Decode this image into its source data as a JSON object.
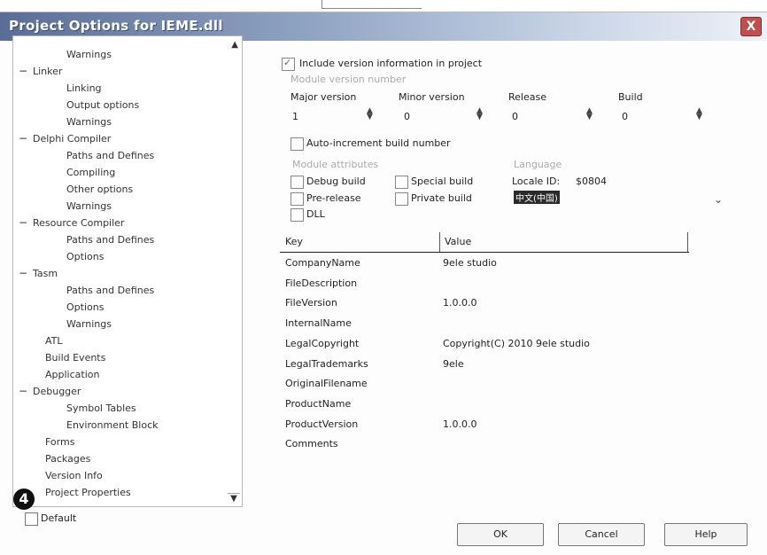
{
  "window": {
    "title": "Project Options for IEME.dll",
    "close_label": "X"
  },
  "tree": {
    "items": [
      {
        "label": "Warnings",
        "level": 2,
        "expander": ""
      },
      {
        "label": "Linker",
        "level": 1,
        "expander": "−"
      },
      {
        "label": "Linking",
        "level": 2,
        "expander": ""
      },
      {
        "label": "Output options",
        "level": 2,
        "expander": ""
      },
      {
        "label": "Warnings",
        "level": 2,
        "expander": ""
      },
      {
        "label": "Delphi Compiler",
        "level": 1,
        "expander": "−"
      },
      {
        "label": "Paths and Defines",
        "level": 2,
        "expander": ""
      },
      {
        "label": "Compiling",
        "level": 2,
        "expander": ""
      },
      {
        "label": "Other options",
        "level": 2,
        "expander": ""
      },
      {
        "label": "Warnings",
        "level": 2,
        "expander": ""
      },
      {
        "label": "Resource Compiler",
        "level": 1,
        "expander": "−"
      },
      {
        "label": "Paths and Defines",
        "level": 2,
        "expander": ""
      },
      {
        "label": "Options",
        "level": 2,
        "expander": ""
      },
      {
        "label": "Tasm",
        "level": 1,
        "expander": "−"
      },
      {
        "label": "Paths and Defines",
        "level": 2,
        "expander": ""
      },
      {
        "label": "Options",
        "level": 2,
        "expander": ""
      },
      {
        "label": "Warnings",
        "level": 2,
        "expander": ""
      },
      {
        "label": "ATL",
        "level": 0,
        "expander": ""
      },
      {
        "label": "Build Events",
        "level": 0,
        "expander": ""
      },
      {
        "label": "Application",
        "level": 0,
        "expander": ""
      },
      {
        "label": "Debugger",
        "level": 1,
        "expander": "−"
      },
      {
        "label": "Symbol Tables",
        "level": 2,
        "expander": ""
      },
      {
        "label": "Environment Block",
        "level": 2,
        "expander": ""
      },
      {
        "label": "Forms",
        "level": 0,
        "expander": ""
      },
      {
        "label": "Packages",
        "level": 0,
        "expander": ""
      },
      {
        "label": "Version Info",
        "level": 0,
        "expander": ""
      },
      {
        "label": "Project Properties",
        "level": 0,
        "expander": ""
      }
    ]
  },
  "badge": "4",
  "default_checkbox": {
    "label": "Default",
    "checked": false
  },
  "version": {
    "include_label": "Include version information in project",
    "include_checked": true,
    "module_version_label": "Module version number",
    "fields": [
      {
        "label": "Major version",
        "value": "1"
      },
      {
        "label": "Minor version",
        "value": "0"
      },
      {
        "label": "Release",
        "value": "0"
      },
      {
        "label": "Build",
        "value": "0"
      }
    ],
    "auto_increment_label": "Auto-increment build number",
    "module_attributes_label": "Module attributes",
    "attributes": [
      {
        "label": "Debug build",
        "checked": false
      },
      {
        "label": "Special build",
        "checked": false
      },
      {
        "label": "Pre-release",
        "checked": false
      },
      {
        "label": "Private build",
        "checked": false
      },
      {
        "label": "DLL",
        "checked": false
      }
    ],
    "language_label": "Language",
    "locale_label": "Locale ID:",
    "locale_value": "$0804",
    "locale_select_text": "中文(中国)"
  },
  "table": {
    "key_header": "Key",
    "value_header": "Value",
    "rows": [
      {
        "key": "CompanyName",
        "value": "9ele studio"
      },
      {
        "key": "FileDescription",
        "value": ""
      },
      {
        "key": "FileVersion",
        "value": "1.0.0.0"
      },
      {
        "key": "InternalName",
        "value": ""
      },
      {
        "key": "LegalCopyright",
        "value": "Copyright(C) 2010 9ele studio"
      },
      {
        "key": "LegalTrademarks",
        "value": "9ele"
      },
      {
        "key": "OriginalFilename",
        "value": ""
      },
      {
        "key": "ProductName",
        "value": ""
      },
      {
        "key": "ProductVersion",
        "value": "1.0.0.0"
      },
      {
        "key": "Comments",
        "value": ""
      }
    ]
  },
  "buttons": {
    "ok": "OK",
    "cancel": "Cancel",
    "help": "Help"
  }
}
